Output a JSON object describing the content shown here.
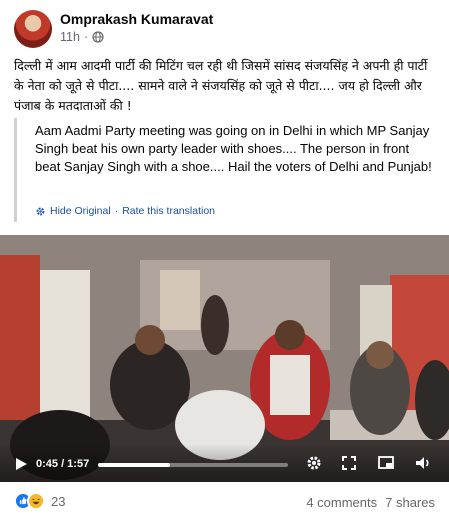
{
  "post": {
    "author": "Omprakash Kumaravat",
    "time": "11h",
    "separator": "·",
    "text": "दिल्ली में आम आदमी पार्टी की मिटिंग चल रही थी जिसमें सांसद संजयसिंह ने अपनी ही पार्टी के नेता को जूते से पीटा.... सामने वाले ने संजयसिंह को जूते से पीटा.... जय हो दिल्ली और पंजाब के मतदाताओं की !",
    "globe_icon": "globe-icon"
  },
  "translation": {
    "text": "Aam Aadmi Party meeting was going on in Delhi in which MP Sanjay Singh beat his own party leader with shoes.... The person in front beat Sanjay Singh with a shoe.... Hail the voters of Delhi and Punjab!",
    "hide_original": "Hide Original",
    "separator": "·",
    "rate": "Rate this translation",
    "gear_icon": "gear-icon"
  },
  "video": {
    "current_time": "0:45",
    "total_time": "1:57",
    "time_display": "0:45 / 1:57",
    "progress_fraction": 0.38,
    "icons": [
      "play-icon",
      "settings-icon",
      "fullscreen-icon",
      "pip-icon",
      "volume-icon"
    ]
  },
  "footer": {
    "reaction_count": "23",
    "comments": "4 comments",
    "shares": "7 shares",
    "reactions": [
      "like-reaction-icon",
      "haha-reaction-icon"
    ]
  },
  "colors": {
    "like": "#1877f2",
    "haha": "#f7b928",
    "link": "#1c4ea0",
    "muted": "#65676b"
  }
}
